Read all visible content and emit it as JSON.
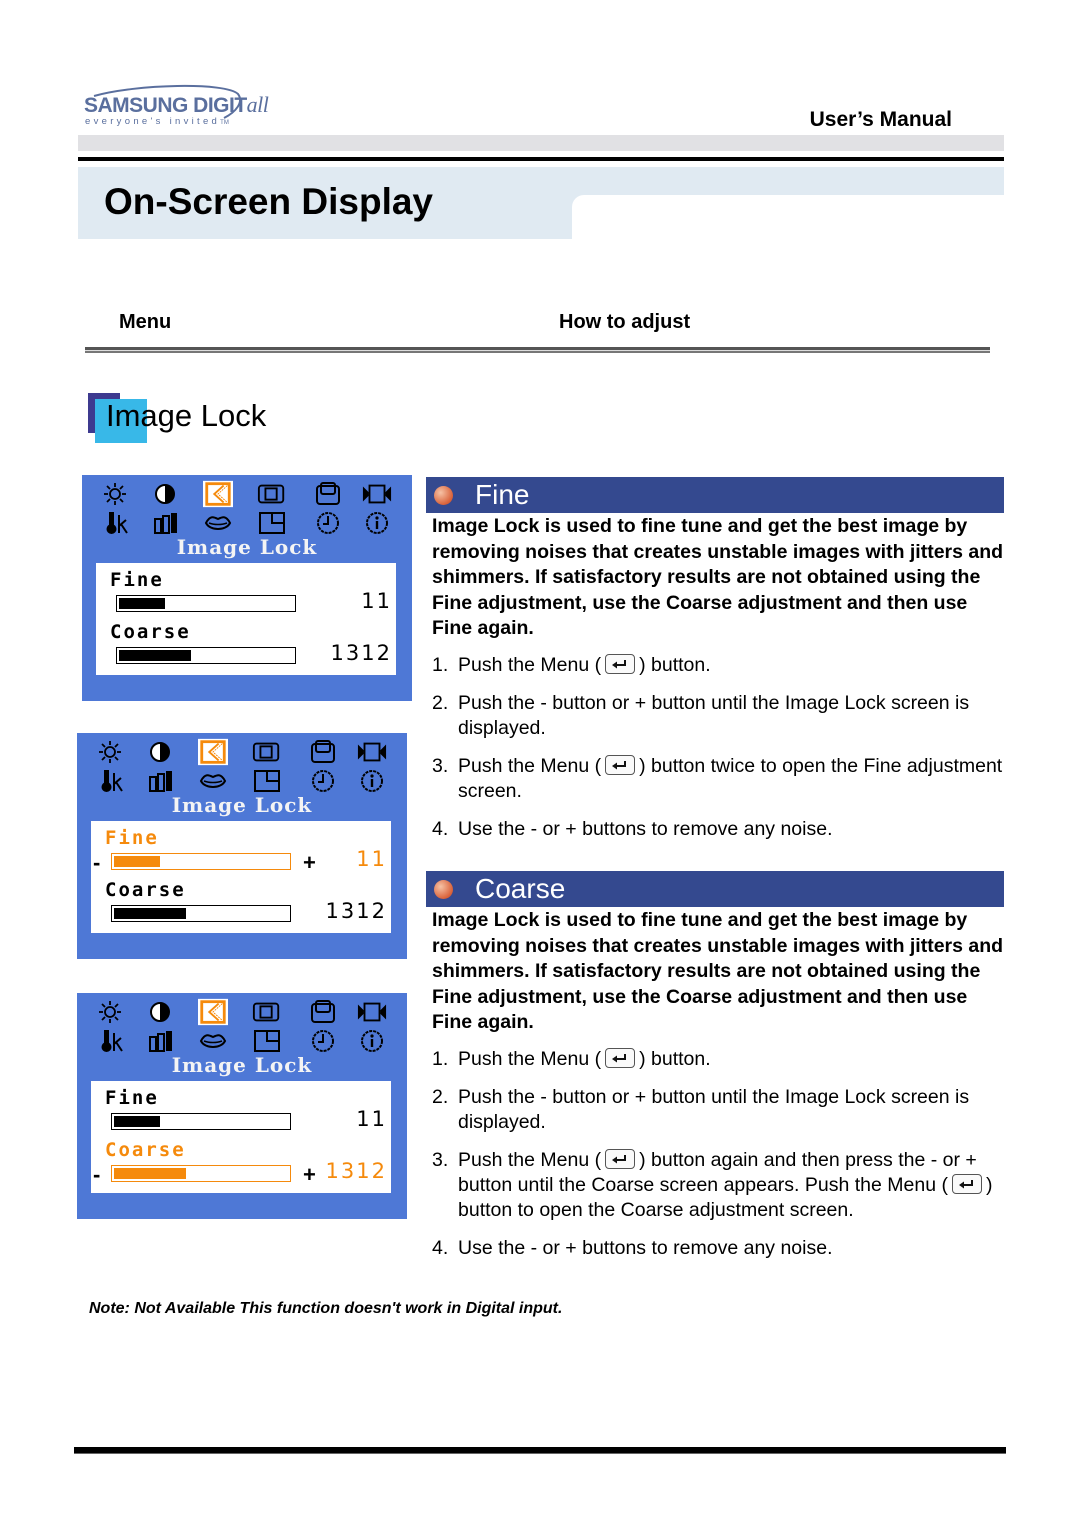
{
  "header": {
    "logo": {
      "brand": "SAMSUNG DIGIT",
      "brand_suffix": "all",
      "tagline": "everyone's invited",
      "tm": "TM"
    },
    "manual_title": "User’s Manual",
    "page_title": "On-Screen Display"
  },
  "columns": {
    "menu": "Menu",
    "how_to_adjust": "How to adjust"
  },
  "section": {
    "title": "Image Lock"
  },
  "osd_panels": [
    {
      "heading": "Image Lock",
      "state": "menu",
      "items": [
        {
          "label": "Fine",
          "value": "11",
          "fill_percent": 27,
          "highlighted": false
        },
        {
          "label": "Coarse",
          "value": "1312",
          "fill_percent": 42,
          "highlighted": false
        }
      ]
    },
    {
      "heading": "Image Lock",
      "state": "fine-adjust",
      "items": [
        {
          "label": "Fine",
          "value": "11",
          "fill_percent": 27,
          "highlighted": true,
          "minus": "-",
          "plus": "+"
        },
        {
          "label": "Coarse",
          "value": "1312",
          "fill_percent": 42,
          "highlighted": false
        }
      ]
    },
    {
      "heading": "Image Lock",
      "state": "coarse-adjust",
      "items": [
        {
          "label": "Fine",
          "value": "11",
          "fill_percent": 27,
          "highlighted": false
        },
        {
          "label": "Coarse",
          "value": "1312",
          "fill_percent": 42,
          "highlighted": true,
          "minus": "-",
          "plus": "+"
        }
      ]
    }
  ],
  "osd_icons": [
    "brightness-icon",
    "contrast-icon",
    "image-lock-icon",
    "position-icon",
    "size-icon",
    "zoom-icon",
    "color-temperature-icon",
    "color-control-icon",
    "language-icon",
    "osd-position-icon",
    "osd-time-icon",
    "information-icon"
  ],
  "fine": {
    "title": "Fine",
    "description": "Image Lock is used to fine tune and get the best image by removing noises that creates unstable images with jitters and shimmers. If satisfactory results are not obtained using the Fine adjustment, use the Coarse adjustment and then use Fine again.",
    "steps": [
      {
        "num": "1.",
        "before": "Push the Menu (",
        "after": ") button."
      },
      {
        "num": "2.",
        "text": "Push the - button or + button until the Image Lock screen is displayed."
      },
      {
        "num": "3.",
        "before": "Push the Menu (",
        "after": ") button twice to open the Fine adjustment screen."
      },
      {
        "num": "4.",
        "text": "Use the - or + buttons to remove any noise."
      }
    ]
  },
  "coarse": {
    "title": "Coarse",
    "description": "Image Lock is used to fine tune and get the best image by removing noises that creates unstable images with jitters and shimmers. If satisfactory results are not obtained using the Fine adjustment, use the Coarse adjustment and then use Fine again.",
    "steps": [
      {
        "num": "1.",
        "before": "Push the Menu (",
        "after": ") button."
      },
      {
        "num": "2.",
        "text": "Push the - button or + button until the Image Lock screen is displayed."
      },
      {
        "num": "3.",
        "before": "Push the Menu (",
        "middle": ") button again and then  press the - or + button until the Coarse screen appears. Push the Menu (",
        "after": ") button to open the Coarse adjustment screen."
      },
      {
        "num": "4.",
        "text": "Use the - or + buttons to remove any noise."
      }
    ]
  },
  "note": "Note: Not Available  This function doesn't work in Digital input.",
  "colors": {
    "osd_blue": "#4e78d6",
    "osd_highlight": "#f58a0c",
    "band_blue": "#34498f",
    "title_band": "#e0eaf2",
    "section_icon_dark": "#3d3a8f",
    "section_icon_light": "#38b8e8"
  }
}
